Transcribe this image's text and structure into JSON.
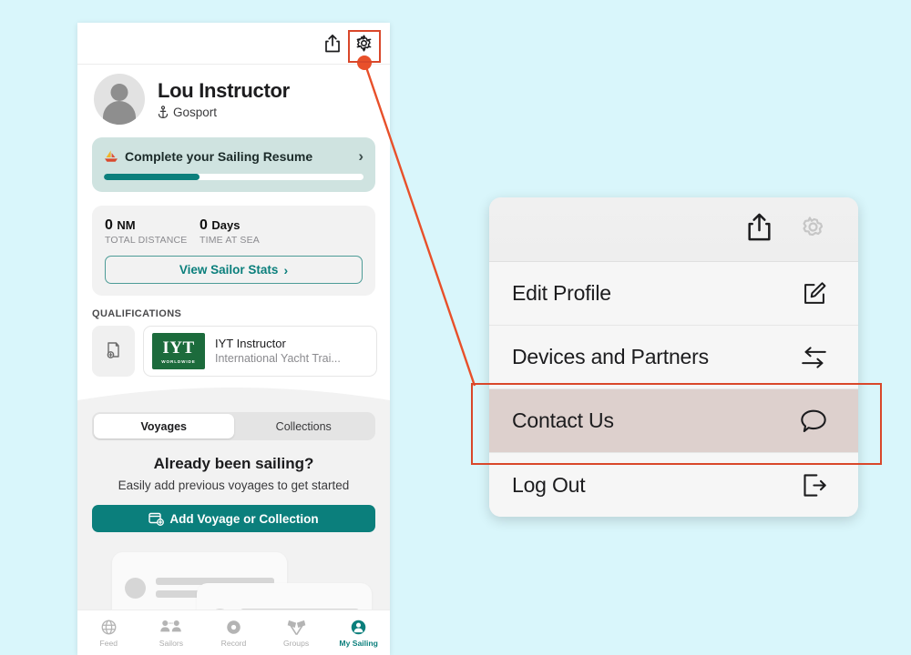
{
  "theme": {
    "background": "#d9f6fb",
    "teal": "#0b7f7c",
    "annotation_red": "#d9472a",
    "highlight_bg": "#ddd0cd",
    "iyt_green": "#1c6b3c"
  },
  "phone": {
    "topbar": {
      "share_icon": "share-icon",
      "settings_icon": "gear-icon"
    },
    "profile": {
      "name": "Lou Instructor",
      "location": "Gosport",
      "location_icon": "anchor-icon",
      "avatar_icon": "person-avatar"
    },
    "resume_card": {
      "icon": "sailboat-emoji",
      "label": "Complete your Sailing Resume",
      "chevron": "›",
      "progress_percent": 37
    },
    "stats": {
      "items": [
        {
          "value": "0",
          "unit": "NM",
          "caption": "TOTAL DISTANCE"
        },
        {
          "value": "0",
          "unit": "Days",
          "caption": "TIME AT SEA"
        }
      ],
      "button_label": "View Sailor Stats",
      "button_chevron": "›"
    },
    "qualifications": {
      "section_title": "QUALIFICATIONS",
      "add_icon": "add-document-icon",
      "card": {
        "logo_main": "IYT",
        "logo_sub": "WORLDWIDE",
        "name": "IYT Instructor",
        "org": "International Yacht Trai..."
      }
    },
    "tabs": {
      "items": [
        {
          "label": "Voyages",
          "active": true
        },
        {
          "label": "Collections",
          "active": false
        }
      ]
    },
    "empty_state": {
      "title": "Already been sailing?",
      "subtitle": "Easily add previous voyages to get started",
      "button_label": "Add Voyage or Collection",
      "button_icon": "add-voyage-icon"
    },
    "tabbar": {
      "items": [
        {
          "label": "Feed",
          "icon": "globe-icon",
          "active": false
        },
        {
          "label": "Sailors",
          "icon": "people-icon",
          "active": false
        },
        {
          "label": "Record",
          "icon": "record-icon",
          "active": false
        },
        {
          "label": "Groups",
          "icon": "flags-icon",
          "active": false
        },
        {
          "label": "My Sailing",
          "icon": "person-circle-icon",
          "active": true
        }
      ]
    }
  },
  "menu": {
    "header": {
      "share_icon": "share-icon",
      "settings_icon": "gear-icon"
    },
    "items": [
      {
        "label": "Edit Profile",
        "icon": "edit-square-icon",
        "highlighted": false
      },
      {
        "label": "Devices and Partners",
        "icon": "swap-arrows-icon",
        "highlighted": false
      },
      {
        "label": "Contact Us",
        "icon": "speech-bubble-icon",
        "highlighted": true
      },
      {
        "label": "Log Out",
        "icon": "logout-icon",
        "highlighted": false
      }
    ]
  }
}
